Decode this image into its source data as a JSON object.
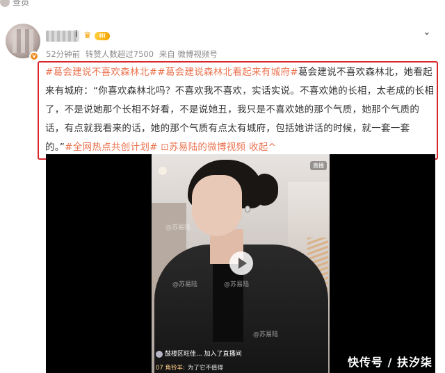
{
  "top": {
    "label": "查员"
  },
  "post": {
    "verified_mark": "v",
    "username_suffix": "i",
    "vip_level": "III",
    "meta": {
      "time": "52分钟前",
      "reposts": "转赞人数超过7500",
      "source": "来自 微博视频号"
    },
    "tags": [
      "#葛会建说不喜欢森林北#",
      "#葛会建说森林北看起来有城府#"
    ],
    "body": "葛会建说不喜欢森林北，她看起来有城府：“你喜欢森林北吗？不喜欢我不喜欢，实话实说。不喜欢她的长相，太老成的长相了，不是说她那个长相不好看，不是说她丑，我只是不喜欢她的那个气质，她那个气质的话，有点就我看来的话，她的那个气质有点太有城府，包括她讲话的时候，就一套一套的。”",
    "trailing_tag": "#全网热点共创计划#",
    "video_link": "苏易陆的微博视频",
    "collapse": "收起",
    "icons": {
      "chevron": "chevron-down-icon",
      "link": "video-link-icon",
      "collapse": "collapse-up-icon",
      "play": "play-icon"
    }
  },
  "video": {
    "live_badge": "直播",
    "watermarks": [
      "@苏易陆",
      "@苏易陆",
      "@苏易陆",
      "@苏易陆"
    ],
    "chat": {
      "line1_text": "鼓楼区旺佳... 加入了直播间",
      "line2_user": "07 角铃羊:",
      "line2_text": "为了它不值得"
    }
  },
  "source_mark": "快传号 / 扶汐柒",
  "colors": {
    "tag": "#eb7350",
    "highlight": "#d8282a",
    "vip": "#f4a300",
    "verify": "#f08a1c"
  }
}
